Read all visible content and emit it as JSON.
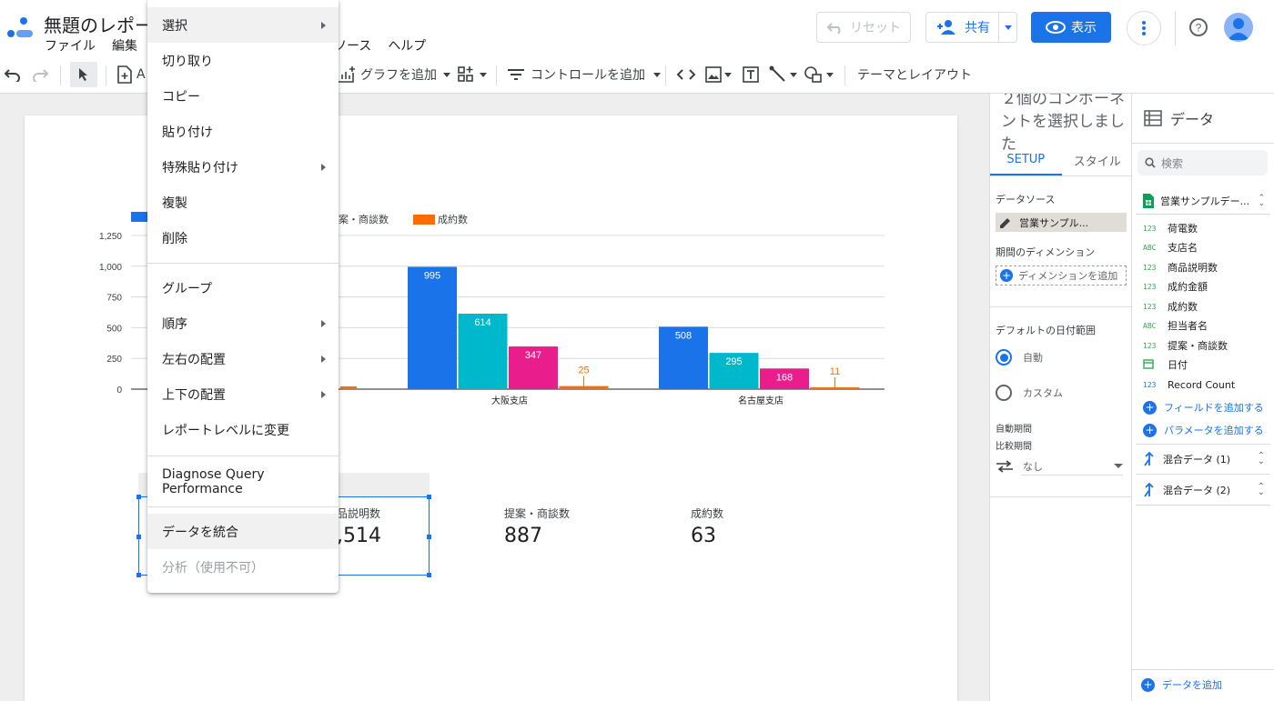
{
  "header": {
    "title": "無題のレポー",
    "menus": [
      "ファイル",
      "編集"
    ],
    "menus_right": [
      "リソース",
      "ヘルプ"
    ],
    "reset_label": "リセット",
    "share_label": "共有",
    "view_label": "表示"
  },
  "toolbar": {
    "add_chart": "グラフを追加",
    "add_control": "コントロールを追加",
    "theme_layout": "テーマとレイアウト",
    "add_page_partial": "A"
  },
  "context_menu": {
    "items": [
      {
        "label": "選択",
        "submenu": true
      },
      {
        "label": "切り取り"
      },
      {
        "label": "コピー"
      },
      {
        "label": "貼り付け"
      },
      {
        "label": "特殊貼り付け",
        "submenu": true
      },
      {
        "label": "複製"
      },
      {
        "label": "削除"
      },
      {
        "label": "グループ"
      },
      {
        "label": "順序",
        "submenu": true
      },
      {
        "label": "左右の配置",
        "submenu": true
      },
      {
        "label": "上下の配置",
        "submenu": true
      },
      {
        "label": "レポートレベルに変更"
      },
      {
        "label": "Diagnose Query Performance"
      },
      {
        "label": "データを統合"
      },
      {
        "label": "分析（使用不可）",
        "disabled": true
      }
    ]
  },
  "chart_data": {
    "type": "bar",
    "categories": [
      "",
      "大阪支店",
      "名古屋支店"
    ],
    "series": [
      {
        "name": "",
        "color": "#1a73e8",
        "values": [
          null,
          995,
          508
        ]
      },
      {
        "name": "",
        "color": "#00b8cc",
        "values": [
          null,
          614,
          295
        ]
      },
      {
        "name": "提案・商談数",
        "color": "#e91e8c",
        "values": [
          null,
          347,
          168
        ]
      },
      {
        "name": "成約数",
        "color": "#ff6d00",
        "values": [
          null,
          25,
          11
        ]
      }
    ],
    "legend_visible": [
      "案・商談数",
      "成約数"
    ],
    "yticks": [
      "1,250",
      "1,000",
      "750",
      "500",
      "250",
      "0"
    ],
    "ylim": [
      0,
      1250
    ],
    "grid": true,
    "legend_position": "top-left"
  },
  "scorecards": [
    {
      "label": "品説明数",
      "value": ",514"
    },
    {
      "label": "提案・商談数",
      "value": "887"
    },
    {
      "label": "成約数",
      "value": "63"
    }
  ],
  "props": {
    "title": "２個のコンポーネントを選択しました",
    "tab_setup": "SETUP",
    "tab_style": "スタイル",
    "datasource_label": "データソース",
    "datasource_value": "営業サンプル...",
    "period_dim_label": "期間のディメンション",
    "add_dimension": "ディメンションを追加",
    "default_range_label": "デフォルトの日付範囲",
    "radio_auto": "自動",
    "radio_custom": "カスタム",
    "auto_period": "自動期間",
    "compare_period": "比較期間",
    "compare_value": "なし"
  },
  "data_panel": {
    "title": "データ",
    "search_placeholder": "検索",
    "datasource": "営業サンプルデー...",
    "fields": [
      {
        "type": "123",
        "name": "荷電数"
      },
      {
        "type": "ABC",
        "name": "支店名"
      },
      {
        "type": "123",
        "name": "商品説明数"
      },
      {
        "type": "123",
        "name": "成約金額"
      },
      {
        "type": "123",
        "name": "成約数"
      },
      {
        "type": "ABC",
        "name": "担当者名"
      },
      {
        "type": "123",
        "name": "提案・商談数"
      },
      {
        "type": "date",
        "name": "日付"
      },
      {
        "type": "123",
        "name": "Record Count"
      }
    ],
    "add_field": "フィールドを追加する",
    "add_param": "パラメータを追加する",
    "blends": [
      "混合データ (1)",
      "混合データ (2)"
    ],
    "add_data": "データを追加"
  }
}
